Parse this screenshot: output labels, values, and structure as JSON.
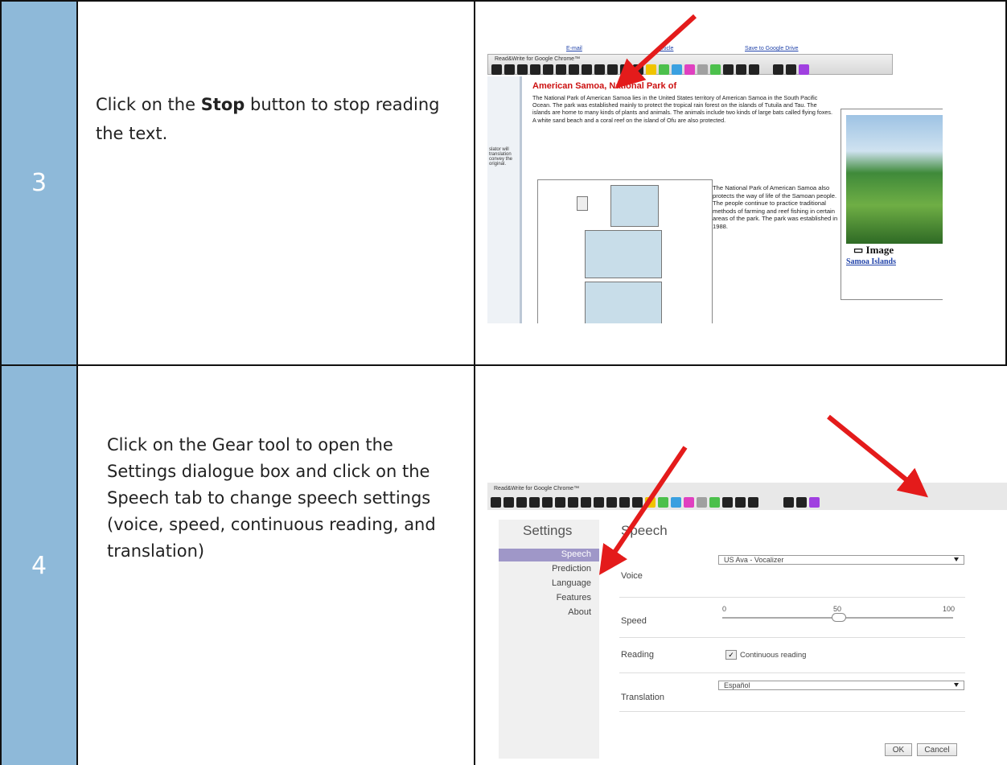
{
  "rows": [
    {
      "number": "3",
      "text_before": "Click on the ",
      "text_bold": "Stop",
      "text_after": " button to stop reading the text."
    },
    {
      "number": "4",
      "text": "Click on the Gear tool to open the Settings dialogue box and click on the Speech tab to change speech settings (voice, speed, continuous reading, and translation)"
    }
  ],
  "shot1": {
    "top_links": [
      "E-mail",
      "Article",
      "Save to Google Drive"
    ],
    "toolbar_title": "Read&Write for Google Chrome™",
    "left_text": "slator will translation convey the original.",
    "article_title": "American Samoa, National Park of",
    "para1": "The National Park of American Samoa lies in the United States territory of American Samoa in the South Pacific Ocean. The park was established mainly to protect the tropical rain forest on the islands of Tutuila and Tau. The islands are home to many kinds of plants and animals. The animals include two kinds of large bats called flying foxes. A white sand beach and a coral reef on the island of Ofu are also protected.",
    "para2": "The National Park of American Samoa also protects the way of life of the Samoan people. The people continue to practice traditional methods of farming and reef fishing in certain areas of the park. The park was established in 1988.",
    "image_caption": "Image",
    "image_link": "Samoa Islands"
  },
  "shot2": {
    "toolbar_title": "Read&Write for Google Chrome™",
    "sidebar_title": "Settings",
    "sidebar_items": [
      "Speech",
      "Prediction",
      "Language",
      "Features",
      "About"
    ],
    "main_title": "Speech",
    "voice_label": "Voice",
    "voice_value": "US Ava - Vocalizer",
    "speed_label": "Speed",
    "speed_min": "0",
    "speed_mid": "50",
    "speed_max": "100",
    "speed_value": 50,
    "reading_label": "Reading",
    "continuous_label": "Continuous reading",
    "translation_label": "Translation",
    "translation_value": "Español",
    "ok_label": "OK",
    "cancel_label": "Cancel"
  },
  "colors": {
    "number_cell": "#8eb9d9",
    "arrow": "#e41b1b",
    "article_title": "#cc1111"
  }
}
